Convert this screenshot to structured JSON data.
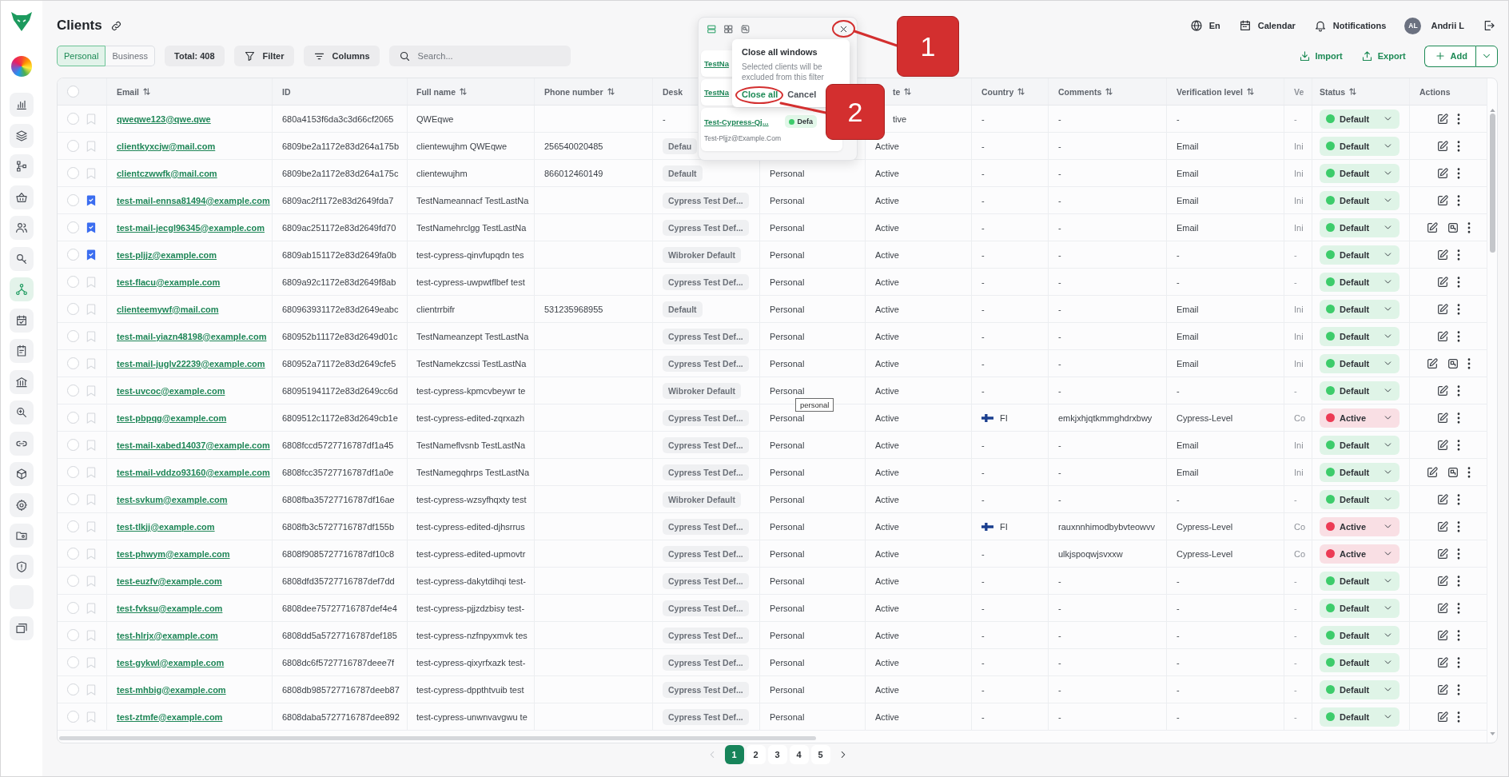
{
  "sidebar": {
    "items": [
      {
        "selected": false
      },
      {
        "selected": false
      },
      {
        "selected": false
      },
      {
        "selected": false
      },
      {
        "selected": false
      },
      {
        "selected": false
      },
      {
        "selected": true
      },
      {
        "selected": false
      },
      {
        "selected": false
      },
      {
        "selected": false
      },
      {
        "selected": false
      },
      {
        "selected": false
      },
      {
        "selected": false
      },
      {
        "selected": false
      },
      {
        "selected": false
      },
      {
        "selected": false
      },
      {
        "selected": false
      },
      {
        "selected": false
      }
    ]
  },
  "header": {
    "title": "Clients",
    "language": "En",
    "calendar": "Calendar",
    "notifications": "Notifications",
    "user": {
      "initials": "AL",
      "name": "Andrii L"
    }
  },
  "toolbar": {
    "segments": [
      {
        "label": "Personal",
        "selected": true
      },
      {
        "label": "Business",
        "selected": false
      }
    ],
    "total": "Total: 408",
    "filter": "Filter",
    "columns": "Columns",
    "search": {
      "placeholder": "Search..."
    },
    "import": "Import",
    "export": "Export",
    "add": "Add"
  },
  "table": {
    "select_all": {
      "checked": false
    },
    "columns": [
      {
        "label": "Email",
        "sortable": true
      },
      {
        "label": "ID",
        "sortable": false
      },
      {
        "label": "Full name",
        "sortable": true
      },
      {
        "label": "Phone number",
        "sortable": true
      },
      {
        "label": "Desk",
        "sortable": false
      },
      {
        "label": "te",
        "sortable": true
      },
      {
        "label": "Country",
        "sortable": true
      },
      {
        "label": "Comments",
        "sortable": true
      },
      {
        "label": "Verification level",
        "sortable": true
      },
      {
        "label": "Ve",
        "sortable": false
      },
      {
        "label": "Status",
        "sortable": true
      },
      {
        "label": "Actions",
        "sortable": false
      }
    ],
    "rows": [
      {
        "checked": false,
        "bookmarked": false,
        "email": "qweqwe123@qwe.qwe",
        "id": "680a4153f6da3c3d66cf2065",
        "full_name": "QWEqwe",
        "desk": "-",
        "desk_tagged": false,
        "column_8": "tive",
        "flag": false,
        "country": "-",
        "comments": "-",
        "verification_level": "-",
        "column_12": "-",
        "status": {
          "label": "Default",
          "color": "#3dcc6b"
        },
        "window_open": false
      },
      {
        "checked": false,
        "bookmarked": false,
        "email": "clientkyxcjw@mail.com",
        "id": "6809be2a1172e83d264a175b",
        "full_name": "clientewujhm QWEqwe",
        "phone_number": "256540020485",
        "desk": "Defau",
        "desk_tagged": true,
        "column_8": "Active",
        "flag": false,
        "country": "-",
        "comments": "-",
        "verification_level": "Email",
        "column_12": "Ini",
        "status": {
          "label": "Default",
          "color": "#3dcc6b"
        },
        "window_open": false
      },
      {
        "checked": false,
        "bookmarked": false,
        "email": "clientczwwfk@mail.com",
        "id": "6809be2a1172e83d264a175c",
        "full_name": "clientewujhm",
        "phone_number": "866012460149",
        "desk": "Default",
        "desk_tagged": true,
        "column_7": "Personal",
        "column_8": "Active",
        "flag": false,
        "country": "-",
        "comments": "-",
        "verification_level": "Email",
        "column_12": "Ini",
        "status": {
          "label": "Default",
          "color": "#3dcc6b"
        },
        "window_open": false
      },
      {
        "checked": false,
        "bookmarked": true,
        "email": "test-mail-ennsa81494@example.com",
        "id": "6809ac2f1172e83d2649fda7",
        "full_name": "TestNameannacf TestLastNa",
        "desk": "Cypress Test Def...",
        "desk_tagged": true,
        "column_7": "Personal",
        "column_8": "Active",
        "flag": false,
        "country": "-",
        "comments": "-",
        "verification_level": "Email",
        "column_12": "Ini",
        "status": {
          "label": "Default",
          "color": "#3dcc6b"
        },
        "window_open": false
      },
      {
        "checked": false,
        "bookmarked": true,
        "email": "test-mail-jecgl96345@example.com",
        "id": "6809ac251172e83d2649fd70",
        "full_name": "TestNamehrclgg TestLastNa",
        "desk": "Cypress Test Def...",
        "desk_tagged": true,
        "column_7": "Personal",
        "column_8": "Active",
        "flag": false,
        "country": "-",
        "comments": "-",
        "verification_level": "Email",
        "column_12": "Ini",
        "status": {
          "label": "Default",
          "color": "#3dcc6b"
        },
        "window_open": true
      },
      {
        "checked": false,
        "bookmarked": true,
        "email": "test-pljjz@example.com",
        "id": "6809ab151172e83d2649fa0b",
        "full_name": "test-cypress-qinvfupqdn tes",
        "desk": "Wibroker Default",
        "desk_tagged": true,
        "column_7": "Personal",
        "column_8": "Active",
        "flag": false,
        "country": "-",
        "comments": "-",
        "verification_level": "-",
        "column_12": "-",
        "status": {
          "label": "Default",
          "color": "#3dcc6b"
        },
        "window_open": false
      },
      {
        "checked": false,
        "bookmarked": false,
        "email": "test-flacu@example.com",
        "id": "6809a92c1172e83d2649f8ab",
        "full_name": "test-cypress-uwpwtflbef test",
        "desk": "Cypress Test Def...",
        "desk_tagged": true,
        "column_7": "Personal",
        "column_8": "Active",
        "flag": false,
        "country": "-",
        "comments": "-",
        "verification_level": "-",
        "column_12": "-",
        "status": {
          "label": "Default",
          "color": "#3dcc6b"
        },
        "window_open": false
      },
      {
        "checked": false,
        "bookmarked": false,
        "email": "clienteemywf@mail.com",
        "id": "680963931172e83d2649eabc",
        "full_name": "clientrrbifr",
        "phone_number": "531235968955",
        "desk": "Default",
        "desk_tagged": true,
        "column_7": "Personal",
        "column_8": "Active",
        "flag": false,
        "country": "-",
        "comments": "-",
        "verification_level": "Email",
        "column_12": "Ini",
        "status": {
          "label": "Default",
          "color": "#3dcc6b"
        },
        "window_open": false
      },
      {
        "checked": false,
        "bookmarked": false,
        "email": "test-mail-yiazn48198@example.com",
        "id": "680952b11172e83d2649d01c",
        "full_name": "TestNameanzept TestLastNa",
        "desk": "Cypress Test Def...",
        "desk_tagged": true,
        "column_7": "Personal",
        "column_8": "Active",
        "flag": false,
        "country": "-",
        "comments": "-",
        "verification_level": "Email",
        "column_12": "Ini",
        "status": {
          "label": "Default",
          "color": "#3dcc6b"
        },
        "window_open": false
      },
      {
        "checked": false,
        "bookmarked": false,
        "email": "test-mail-juglv22239@example.com",
        "id": "680952a71172e83d2649cfe5",
        "full_name": "TestNamekzcssi TestLastNa",
        "desk": "Cypress Test Def...",
        "desk_tagged": true,
        "column_7": "Personal",
        "column_8": "Active",
        "flag": false,
        "country": "-",
        "comments": "-",
        "verification_level": "Email",
        "column_12": "Ini",
        "status": {
          "label": "Default",
          "color": "#3dcc6b"
        },
        "window_open": true
      },
      {
        "checked": false,
        "bookmarked": false,
        "email": "test-uvcoc@example.com",
        "id": "680951941172e83d2649cc6d",
        "full_name": "test-cypress-kpmcvbeywr te",
        "desk": "Wibroker Default",
        "desk_tagged": true,
        "column_7": "Personal",
        "column_8": "Active",
        "flag": false,
        "country": "-",
        "comments": "-",
        "verification_level": "-",
        "column_12": "-",
        "status": {
          "label": "Default",
          "color": "#3dcc6b"
        },
        "window_open": false
      },
      {
        "checked": false,
        "bookmarked": false,
        "email": "test-pbpqg@example.com",
        "id": "6809512c1172e83d2649cb1e",
        "full_name": "test-cypress-edited-zqrxazh",
        "desk": "Cypress Test Def...",
        "desk_tagged": true,
        "column_7": "Personal",
        "column_8": "Active",
        "flag": true,
        "country": "FI",
        "comments": "emkjxhjqtkmmghdrxbwy",
        "verification_level": "Cypress-Level",
        "column_12": "Co",
        "status": {
          "label": "Active",
          "color": "#ec3b55"
        },
        "window_open": false
      },
      {
        "checked": false,
        "bookmarked": false,
        "email": "test-mail-xabed14037@example.com",
        "id": "6808fccd5727716787df1a45",
        "full_name": "TestNameflvsnb TestLastNa",
        "desk": "Cypress Test Def...",
        "desk_tagged": true,
        "column_7": "Personal",
        "column_8": "Active",
        "flag": false,
        "country": "-",
        "comments": "-",
        "verification_level": "Email",
        "column_12": "Ini",
        "status": {
          "label": "Default",
          "color": "#3dcc6b"
        },
        "window_open": false
      },
      {
        "checked": false,
        "bookmarked": false,
        "email": "test-mail-vddzo93160@example.com",
        "id": "6808fcc35727716787df1a0e",
        "full_name": "TestNamegqhrps TestLastNa",
        "desk": "Cypress Test Def...",
        "desk_tagged": true,
        "column_7": "Personal",
        "column_8": "Active",
        "flag": false,
        "country": "-",
        "comments": "-",
        "verification_level": "Email",
        "column_12": "Ini",
        "status": {
          "label": "Default",
          "color": "#3dcc6b"
        },
        "window_open": true
      },
      {
        "checked": false,
        "bookmarked": false,
        "email": "test-svkum@example.com",
        "id": "6808fba35727716787df16ae",
        "full_name": "test-cypress-wzsyfhqxty test",
        "desk": "Wibroker Default",
        "desk_tagged": true,
        "column_7": "Personal",
        "column_8": "Active",
        "flag": false,
        "country": "-",
        "comments": "-",
        "verification_level": "-",
        "column_12": "-",
        "status": {
          "label": "Default",
          "color": "#3dcc6b"
        },
        "window_open": false
      },
      {
        "checked": false,
        "bookmarked": false,
        "email": "test-tlkjj@example.com",
        "id": "6808fb3c5727716787df155b",
        "full_name": "test-cypress-edited-djhsrrus",
        "desk": "Cypress Test Def...",
        "desk_tagged": true,
        "column_7": "Personal",
        "column_8": "Active",
        "flag": true,
        "country": "FI",
        "comments": "rauxnnhimodbybvteowvv",
        "verification_level": "Cypress-Level",
        "column_12": "Co",
        "status": {
          "label": "Active",
          "color": "#ec3b55"
        },
        "window_open": false
      },
      {
        "checked": false,
        "bookmarked": false,
        "email": "test-phwym@example.com",
        "id": "6808f9085727716787df10c8",
        "full_name": "test-cypress-edited-upmovtr",
        "desk": "Cypress Test Def...",
        "desk_tagged": true,
        "column_7": "Personal",
        "column_8": "Active",
        "flag": false,
        "country": "-",
        "comments": "ulkjspoqwjsvxxw",
        "verification_level": "Cypress-Level",
        "column_12": "Co",
        "status": {
          "label": "Active",
          "color": "#ec3b55"
        },
        "window_open": false
      },
      {
        "checked": false,
        "bookmarked": false,
        "email": "test-euzfv@example.com",
        "id": "6808dfd35727716787def7dd",
        "full_name": "test-cypress-dakytdihqi test-",
        "desk": "Cypress Test Def...",
        "desk_tagged": true,
        "column_7": "Personal",
        "column_8": "Active",
        "flag": false,
        "country": "-",
        "comments": "-",
        "verification_level": "-",
        "column_12": "-",
        "status": {
          "label": "Default",
          "color": "#3dcc6b"
        },
        "window_open": false
      },
      {
        "checked": false,
        "bookmarked": false,
        "email": "test-fvksu@example.com",
        "id": "6808dee75727716787def4e4",
        "full_name": "test-cypress-pjjzdzbisy test-",
        "desk": "Cypress Test Def...",
        "desk_tagged": true,
        "column_7": "Personal",
        "column_8": "Active",
        "flag": false,
        "country": "-",
        "comments": "-",
        "verification_level": "-",
        "column_12": "-",
        "status": {
          "label": "Default",
          "color": "#3dcc6b"
        },
        "window_open": false
      },
      {
        "checked": false,
        "bookmarked": false,
        "email": "test-hlrjx@example.com",
        "id": "6808dd5a5727716787def185",
        "full_name": "test-cypress-nzfnpyxmvk tes",
        "desk": "Cypress Test Def...",
        "desk_tagged": true,
        "column_7": "Personal",
        "column_8": "Active",
        "flag": false,
        "country": "-",
        "comments": "-",
        "verification_level": "-",
        "column_12": "-",
        "status": {
          "label": "Default",
          "color": "#3dcc6b"
        },
        "window_open": false
      },
      {
        "checked": false,
        "bookmarked": false,
        "email": "test-gykwl@example.com",
        "id": "6808dc6f5727716787deee7f",
        "full_name": "test-cypress-qixyrfxazk test-",
        "desk": "Cypress Test Def...",
        "desk_tagged": true,
        "column_7": "Personal",
        "column_8": "Active",
        "flag": false,
        "country": "-",
        "comments": "-",
        "verification_level": "-",
        "column_12": "-",
        "status": {
          "label": "Default",
          "color": "#3dcc6b"
        },
        "window_open": false
      },
      {
        "checked": false,
        "bookmarked": false,
        "email": "test-mhbig@example.com",
        "id": "6808db985727716787deeb87",
        "full_name": "test-cypress-dppthtvuib test",
        "desk": "Cypress Test Def...",
        "desk_tagged": true,
        "column_7": "Personal",
        "column_8": "Active",
        "flag": false,
        "country": "-",
        "comments": "-",
        "verification_level": "-",
        "column_12": "-",
        "status": {
          "label": "Default",
          "color": "#3dcc6b"
        },
        "window_open": false
      },
      {
        "checked": false,
        "bookmarked": false,
        "email": "test-ztmfe@example.com",
        "id": "6808daba5727716787dee892",
        "full_name": "test-cypress-unwnvavgwu te",
        "desk": "Cypress Test Def...",
        "desk_tagged": true,
        "column_7": "Personal",
        "column_8": "Active",
        "flag": false,
        "country": "-",
        "comments": "-",
        "verification_level": "-",
        "column_12": "-",
        "status": {
          "label": "Default",
          "color": "#3dcc6b"
        },
        "window_open": false
      }
    ]
  },
  "pagination": {
    "previous": {
      "disabled": true
    },
    "pages": [
      {
        "label": "1",
        "selected": true
      },
      {
        "label": "2",
        "selected": false
      },
      {
        "label": "3",
        "selected": false
      },
      {
        "label": "4",
        "selected": false
      },
      {
        "label": "5",
        "selected": false
      }
    ],
    "next": {
      "disabled": false
    }
  },
  "windows_panel": {
    "views": [
      {
        "selected": true
      },
      {
        "selected": false
      },
      {
        "selected": false
      }
    ],
    "cards": [
      {
        "name": "TestNa"
      },
      {
        "name": "TestNa"
      },
      {
        "name": "Test-Cypress-Qj...",
        "status": {
          "label": "Defa",
          "color": "#3dcc6b"
        },
        "email": "Test-Pljjz@Example.Com"
      }
    ],
    "confirm": {
      "title": "Close all windows",
      "text": "Selected clients will be excluded from this filter",
      "confirm": "Close all",
      "cancel": "Cancel"
    }
  },
  "hover_tooltip": "personal",
  "annotations": [
    {
      "label": "1"
    },
    {
      "label": "2"
    }
  ]
}
